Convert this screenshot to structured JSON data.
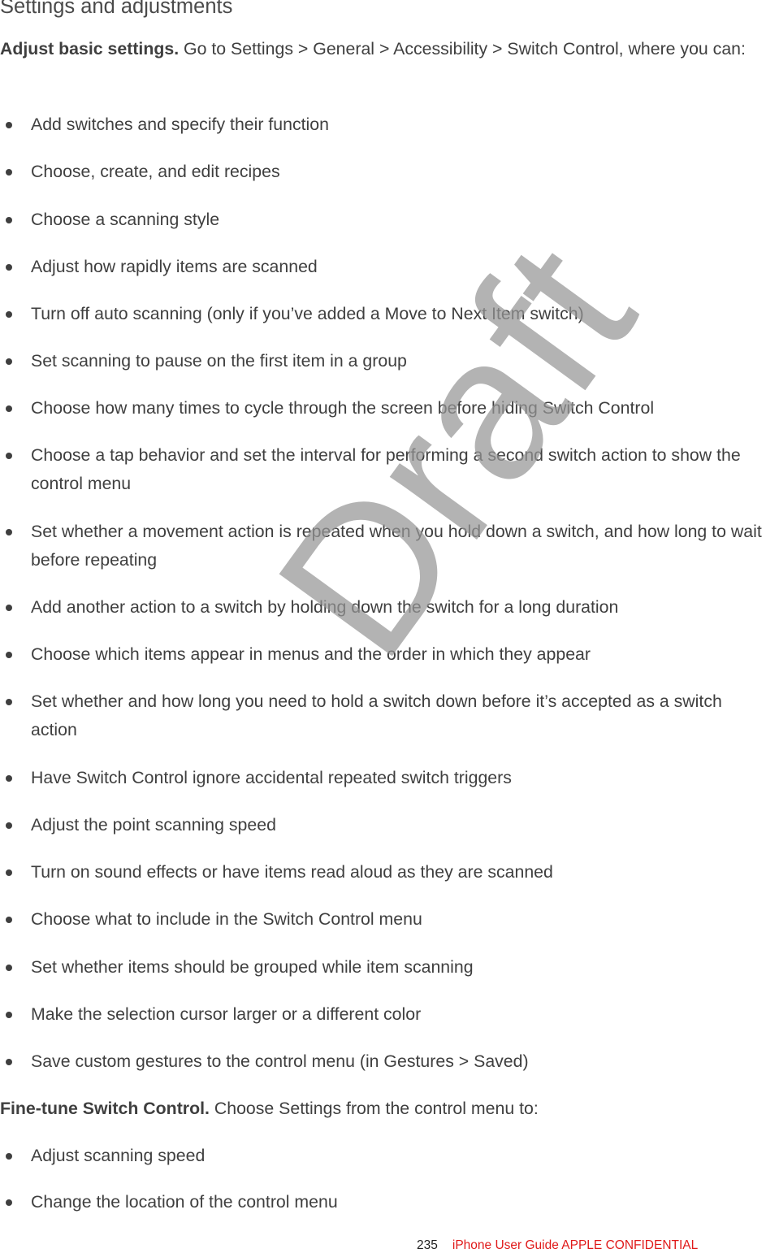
{
  "heading": "Settings and adjustments",
  "intro": {
    "bold": "Adjust basic settings.",
    "text": " Go to Settings > General > Accessibility > Switch Control, where you can:"
  },
  "basic_items": [
    "Add switches and specify their function",
    "Choose, create, and edit recipes",
    "Choose a scanning style",
    "Adjust how rapidly items are scanned",
    "Turn off auto scanning (only if you’ve added a Move to Next Item switch)",
    "Set scanning to pause on the first item in a group",
    "Choose how many times to cycle through the screen before hiding Switch Control",
    "Choose a tap behavior and set the interval for performing a second switch action to show the control menu",
    "Set whether a movement action is repeated when you hold down a switch, and how long to wait before repeating",
    "Add another action to a switch by holding down the switch for a long duration",
    "Choose which items appear in menus and the order in which they appear",
    "Set whether and how long you need to hold a switch down before it’s accepted as a switch action",
    "Have Switch Control ignore accidental repeated switch triggers",
    "Adjust the point scanning speed",
    "Turn on sound effects or have items read aloud as they are scanned",
    "Choose what to include in the Switch Control menu",
    "Set whether items should be grouped while item scanning",
    "Make the selection cursor larger or a different color",
    "Save custom gestures to the control menu (in Gestures > Saved)"
  ],
  "finetune": {
    "bold": "Fine-tune Switch Control.",
    "text": " Choose Settings from the control menu to:"
  },
  "finetune_items": [
    "Adjust scanning speed",
    "Change the location of the control menu"
  ],
  "watermark": "Draft",
  "footer": {
    "page_number": "235",
    "guide_label": "iPhone User Guide  APPLE CONFIDENTIAL",
    "guide_color": "#e01a1a"
  }
}
